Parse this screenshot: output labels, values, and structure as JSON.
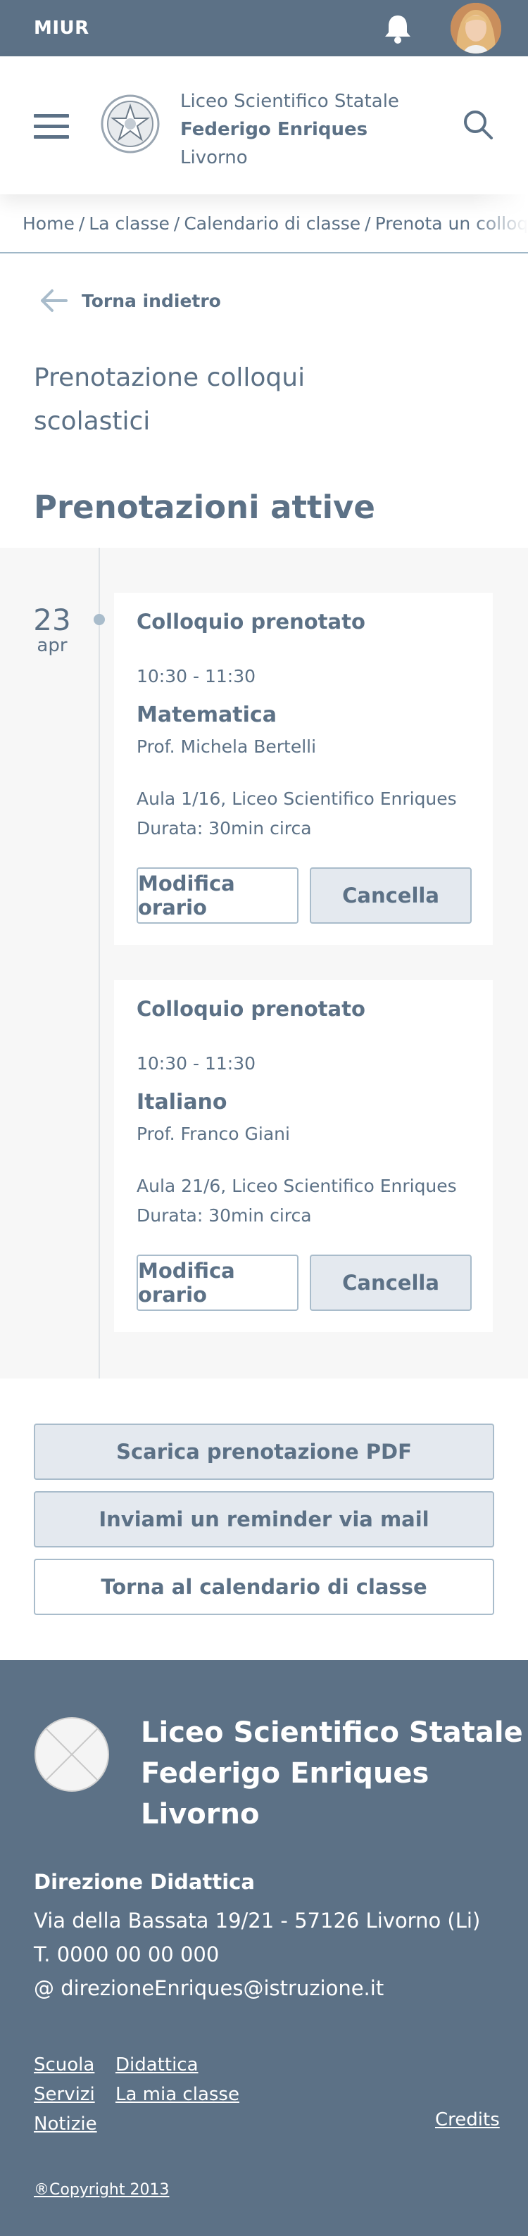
{
  "topbar": {
    "brand": "MIUR",
    "notification_icon": "bell-icon",
    "avatar": "user-avatar"
  },
  "header": {
    "school_line1": "Liceo Scientifico Statale",
    "school_line2": "Federigo Enriques",
    "school_line3": "Livorno",
    "menu_icon": "hamburger-icon",
    "search_icon": "search-icon"
  },
  "breadcrumb": {
    "items": [
      "Home",
      "La classe",
      "Calendario di classe",
      "Prenota un colloquio"
    ],
    "separator": "/"
  },
  "back": {
    "label": "Torna indietro"
  },
  "page": {
    "title_line1": "Prenotazione colloqui",
    "title_line2": "scolastici",
    "section_title": "Prenotazioni attive"
  },
  "timeline": {
    "day": "23",
    "month": "apr",
    "bookings": [
      {
        "status": "Colloquio prenotato",
        "time": "10:30 - 11:30",
        "subject": "Matematica",
        "teacher": "Prof. Michela Bertelli",
        "room": "Aula 1/16, Liceo Scientifico Enriques",
        "duration": "Durata: 30min circa",
        "edit_label": "Modifica orario",
        "cancel_label": "Cancella"
      },
      {
        "status": "Colloquio prenotato",
        "time": "10:30 - 11:30",
        "subject": "Italiano",
        "teacher": "Prof. Franco Giani",
        "room": "Aula 21/6, Liceo Scientifico Enriques",
        "duration": "Durata: 30min circa",
        "edit_label": "Modifica orario",
        "cancel_label": "Cancella"
      }
    ]
  },
  "actions": {
    "pdf": "Scarica prenotazione PDF",
    "reminder": "Inviami un reminder via mail",
    "calendar": "Torna al calendario di classe"
  },
  "footer": {
    "name_line1": "Liceo Scientifico Statale",
    "name_line2": "Federigo Enriques",
    "name_line3": "Livorno",
    "direction_title": "Direzione Didattica",
    "address": "Via della Bassata 19/21 - 57126 Livorno (Li)",
    "phone": "T. 0000 00 00 000",
    "email": "@ direzioneEnriques@istruzione.it",
    "links_col1": [
      "Scuola",
      "Servizi",
      "Notizie"
    ],
    "links_col2": [
      "Didattica",
      "La mia classe"
    ],
    "credits": "Credits",
    "copyright": "®Copyright 2013"
  },
  "colors": {
    "primary": "#5c7186",
    "light_border": "#a9bccb",
    "button_fill": "#e4e9ef",
    "timeline_bg": "#f7f7f7"
  }
}
